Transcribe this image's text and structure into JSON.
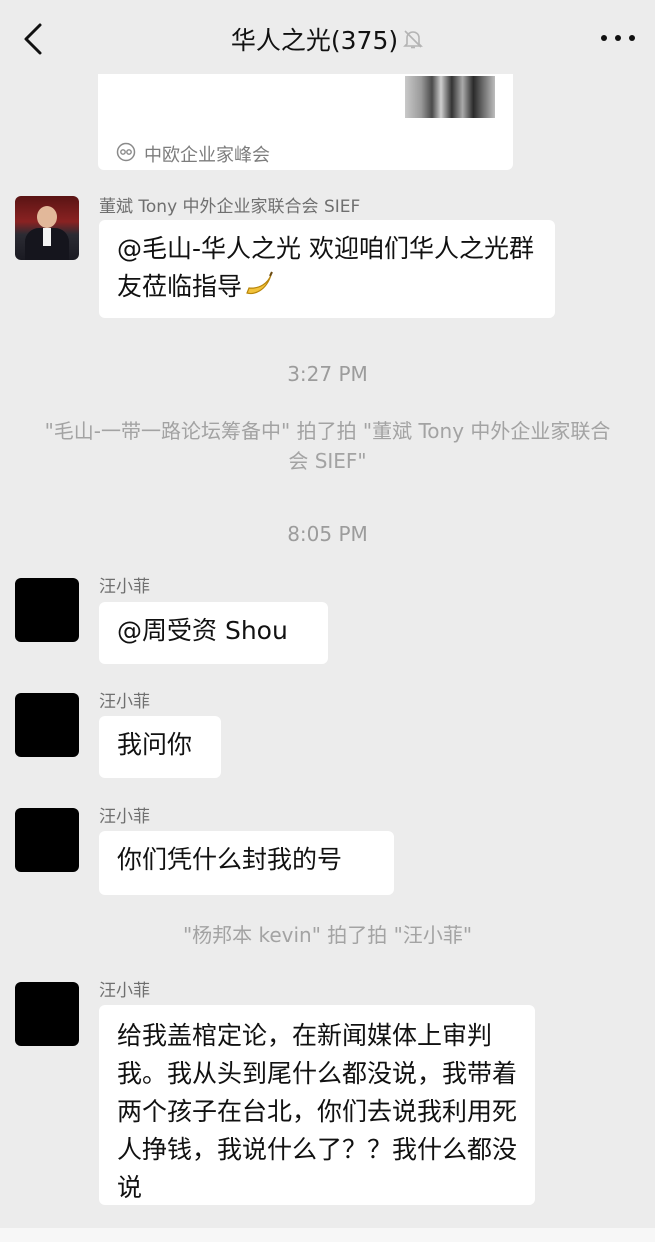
{
  "header": {
    "title": "华人之光(375)",
    "back_icon": "chevron-left-icon",
    "mute_icon": "bell-muted-icon",
    "more_icon": "more-dots-icon"
  },
  "shared_card": {
    "source": "中欧企业家峰会",
    "source_icon": "mini-program-icon"
  },
  "messages": [
    {
      "sender": "董斌 Tony 中外企业家联合会 SIEF",
      "text": "@毛山-华人之光 欢迎咱们华人之光群友莅临指导",
      "emoji": "banana-icon"
    },
    {
      "sender": "汪小菲",
      "text": "@周受资 Shou"
    },
    {
      "sender": "汪小菲",
      "text": "我问你"
    },
    {
      "sender": "汪小菲",
      "text": "你们凭什么封我的号"
    },
    {
      "sender": "汪小菲",
      "text": "给我盖棺定论，在新闻媒体上审判我。我从头到尾什么都没说，我带着两个孩子在台北，你们去说我利用死人挣钱，我说什么了？？我什么都没说"
    }
  ],
  "timestamps": [
    "3:27 PM",
    "8:05 PM"
  ],
  "system_notices": [
    "\"毛山-一带一路论坛筹备中\" 拍了拍 \"董斌 Tony 中外企业家联合会 SIEF\"",
    "\"杨邦本 kevin\" 拍了拍 \"汪小菲\""
  ],
  "colors": {
    "background": "#ececec",
    "bubble": "#ffffff",
    "meta_text": "#9c9c9c"
  }
}
